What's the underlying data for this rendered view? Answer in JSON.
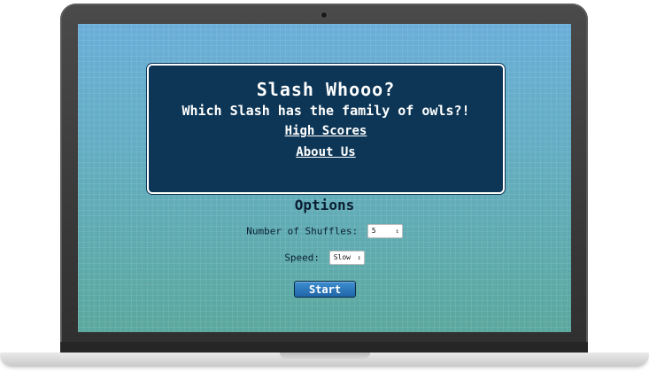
{
  "header": {
    "title": "Slash Whooo?",
    "subtitle": "Which Slash has the family of owls?!",
    "links": [
      {
        "label": "High Scores"
      },
      {
        "label": "About Us"
      }
    ]
  },
  "options": {
    "title": "Options",
    "shuffles": {
      "label": "Number of Shuffles:",
      "value": "5"
    },
    "speed": {
      "label": "Speed:",
      "value": "Slow"
    }
  },
  "start": {
    "label": "Start"
  },
  "icons": {
    "select_arrow": "updown-arrow-icon"
  },
  "colors": {
    "panel_bg": "#0d3656",
    "button_bg": "#2b78bd",
    "screen_top": "#6aaed8",
    "screen_bottom": "#5ba89e"
  }
}
